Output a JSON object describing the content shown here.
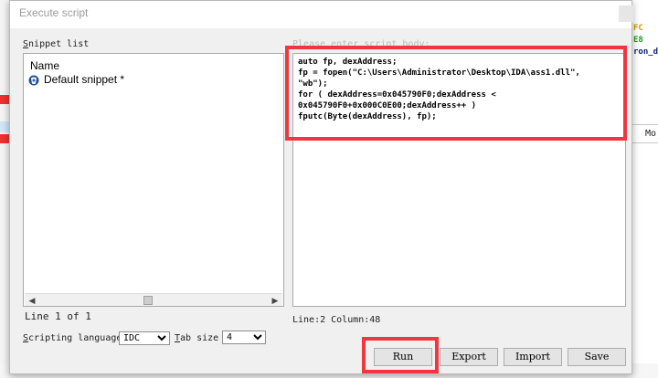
{
  "dialog": {
    "title": "Execute script",
    "snippet_list_label_prefix": "S",
    "snippet_list_label_rest": "nippet list",
    "script_body_label": "Please enter script body:",
    "list_header": "Name",
    "snippets": [
      {
        "label": "Default snippet *",
        "icon": "snippet-icon"
      }
    ],
    "line_status": "Line 1 of 1",
    "cursor_status": "Line:2  Column:48",
    "scripting_language_label_prefix": "S",
    "scripting_language_label_rest": "cripting language",
    "scripting_language_value": "IDC",
    "tab_size_label_prefix": "T",
    "tab_size_label_rest": "ab size",
    "tab_size_value": "4",
    "buttons": {
      "run": "Run",
      "export": "Export",
      "import": "Import",
      "save": "Save"
    }
  },
  "script_lines": [
    "auto fp, dexAddress;",
    "fp = fopen(\"C:\\Users\\Administrator\\Desktop\\IDA\\ass1.dll\",",
    "\"wb\");",
    "for ( dexAddress=0x045790F0;dexAddress <",
    "0x045790F0+0x000C0E00;dexAddress++ )",
    "fputc(Byte(dexAddress), fp);"
  ],
  "background_window": {
    "code_fragments": [
      "FC",
      "E8",
      "ron_d"
    ],
    "column_header": "Mo"
  },
  "colors": {
    "highlight": "#f0363e",
    "dialog_bg": "#f0f0f0",
    "code_color_1": "#c8a000",
    "code_color_2": "#1aa01a",
    "code_color_3": "#0a1e7a"
  }
}
